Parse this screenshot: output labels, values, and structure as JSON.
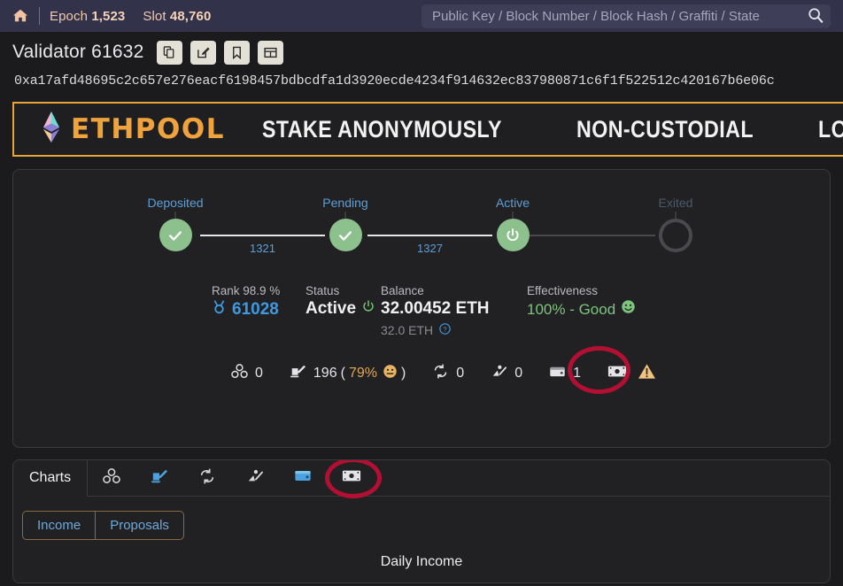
{
  "topbar": {
    "home_icon": "home-icon",
    "epoch_label": "Epoch",
    "epoch_value": "1,523",
    "slot_label": "Slot",
    "slot_value": "48,760",
    "search_placeholder": "Public Key / Block Number / Block Hash / Graffiti / State",
    "search_value": "",
    "search_icon": "magnifier-icon"
  },
  "header": {
    "title": "Validator 61632",
    "buttons": [
      {
        "name": "copy-button",
        "icon": "copy-icon"
      },
      {
        "name": "edit-button",
        "icon": "pencil-square-icon"
      },
      {
        "name": "bookmark-button",
        "icon": "bookmark-icon"
      },
      {
        "name": "table-button",
        "icon": "grid-table-icon"
      }
    ],
    "pubkey": "0xa17afd48695c2c657e276eacf6198457bdbcdfa1d3920ecde4234f914632ec837980871c6f1f522512c420167b6e06c"
  },
  "banner": {
    "logo_icon": "ethereum-diamond-icon",
    "brand": "ETHPOOL",
    "slogans": [
      "STAKE ANONYMOUSLY",
      "NON-CUSTODIAL",
      "LOW"
    ],
    "border_color": "#e8a33d",
    "brand_color": "#f0a33c"
  },
  "timeline": {
    "nodes": [
      {
        "label": "Deposited",
        "icon": "check-icon",
        "state": "done"
      },
      {
        "label": "Pending",
        "icon": "check-icon",
        "state": "done"
      },
      {
        "label": "Active",
        "icon": "power-icon",
        "state": "active"
      },
      {
        "label": "Exited",
        "icon": "empty-circle-icon",
        "state": "inactive"
      }
    ],
    "connector_labels": [
      "1321",
      "1327"
    ],
    "done_color": "#8cc08c",
    "label_color": "#5c9fd6"
  },
  "stats": {
    "rank": {
      "label": "Rank 98.9 %",
      "icon": "medal-icon",
      "value": "61028"
    },
    "status": {
      "label": "Status",
      "value": "Active",
      "icon": "power-icon"
    },
    "balance": {
      "label": "Balance",
      "value": "32.00452 ETH",
      "sub": "32.0 ETH",
      "help_icon": "question-circle-icon"
    },
    "effectiveness": {
      "label": "Effectiveness",
      "value": "100% - Good",
      "icon": "smiley-happy-icon"
    }
  },
  "icon_stats": [
    {
      "name": "blocks-stat",
      "icon": "blocks-icon",
      "value": "0"
    },
    {
      "name": "attestations-stat",
      "icon": "attestation-icon",
      "value": "196",
      "pct": "79%",
      "emoji": "neutral-face-icon",
      "open": "(",
      "close": ")"
    },
    {
      "name": "sync-stat",
      "icon": "sync-icon",
      "value": "0"
    },
    {
      "name": "slashing-stat",
      "icon": "slashed-icon",
      "value": "0"
    },
    {
      "name": "deposits-stat",
      "icon": "wallet-icon",
      "value": "1"
    },
    {
      "name": "income-stat",
      "icon": "money-bill-icon",
      "warning_icon": "warning-triangle-icon",
      "value": ""
    }
  ],
  "annotations": {
    "circle_color": "#b30f33",
    "circles": [
      "income-stat-highlight",
      "money-tab-highlight"
    ]
  },
  "charts_card": {
    "tabs": [
      {
        "name": "tab-charts",
        "label": "Charts",
        "active": true
      },
      {
        "name": "tab-blocks",
        "icon": "blocks-icon",
        "active": false
      },
      {
        "name": "tab-attestations",
        "icon": "attestation-icon",
        "active": false
      },
      {
        "name": "tab-sync",
        "icon": "sync-icon",
        "active": false
      },
      {
        "name": "tab-slashings",
        "icon": "slashed-icon",
        "active": false
      },
      {
        "name": "tab-deposits",
        "icon": "wallet-icon",
        "active": false
      },
      {
        "name": "tab-income",
        "icon": "money-bill-icon",
        "active": false
      }
    ],
    "subtabs": [
      {
        "name": "subtab-income",
        "label": "Income"
      },
      {
        "name": "subtab-proposals",
        "label": "Proposals"
      }
    ],
    "chart_title": "Daily Income"
  }
}
